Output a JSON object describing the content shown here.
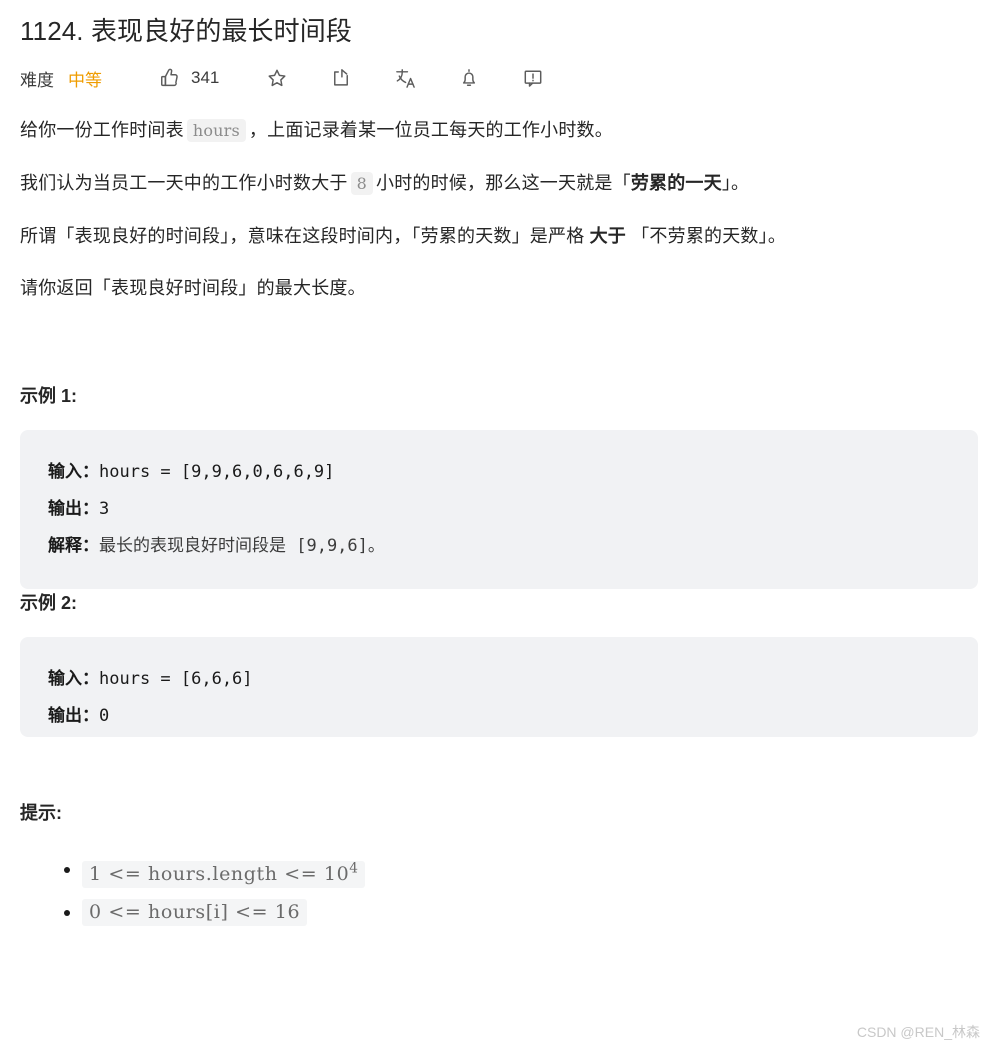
{
  "problem": {
    "title": "1124. 表现良好的最长时间段"
  },
  "meta": {
    "difficulty_label": "难度",
    "difficulty_value": "中等",
    "difficulty_color": "#ef9c00",
    "likes_icon": "thumbs-up-icon",
    "likes_count": "341",
    "actions": [
      {
        "icon": "star-icon",
        "name": "favorite"
      },
      {
        "icon": "share-icon",
        "name": "share"
      },
      {
        "icon": "translate-icon",
        "name": "translate"
      },
      {
        "icon": "bell-icon",
        "name": "subscribe"
      },
      {
        "icon": "feedback-icon",
        "name": "feedback"
      }
    ]
  },
  "description": {
    "p1_before": "给你一份工作时间表",
    "p1_code": "hours",
    "p1_after": "，上面记录着某一位员工每天的工作小时数。",
    "p2_before": "我们认为当员工一天中的工作小时数大于",
    "p2_code": "8",
    "p2_mid": "小时的时候，那么这一天就是「",
    "p2_bold": "劳累的一天",
    "p2_after": "」。",
    "p3_before": "所谓「表现良好的时间段」，意味在这段时间内，「劳累的天数」是严格 ",
    "p3_bold": "大于",
    "p3_after": " 「不劳累的天数」。",
    "p4": "请你返回「表现良好时间段」的最大长度。"
  },
  "examples": [
    {
      "heading": "示例 1:",
      "lines": [
        {
          "label": "输入：",
          "value": "hours = [9,9,6,0,6,6,9]"
        },
        {
          "label": "输出：",
          "value": "3"
        },
        {
          "label": "解释：",
          "value": "最长的表现良好时间段是 [9,9,6]。"
        }
      ]
    },
    {
      "heading": "示例 2:",
      "lines": [
        {
          "label": "输入：",
          "value": "hours = [6,6,6]"
        },
        {
          "label": "输出：",
          "value": "0"
        }
      ]
    }
  ],
  "constraints": {
    "heading": "提示:",
    "items": [
      {
        "expr_main": "1 <= hours.length <= 10",
        "expr_sup": "4"
      },
      {
        "expr_main": "0 <= hours[i] <= 16",
        "expr_sup": ""
      }
    ]
  },
  "watermark": {
    "text": "CSDN @REN_林森"
  }
}
